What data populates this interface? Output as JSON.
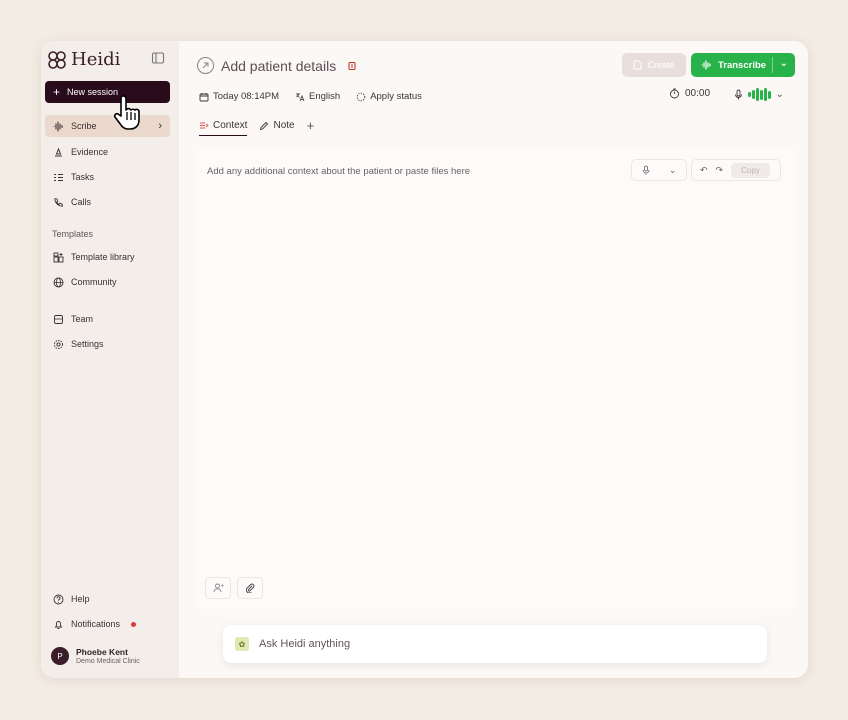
{
  "sidebar": {
    "logo_text": "Heidi",
    "new_session_label": "New session",
    "nav": [
      {
        "label": "Scribe",
        "icon": "waveform-icon"
      },
      {
        "label": "Evidence",
        "icon": "evidence-icon"
      },
      {
        "label": "Tasks",
        "icon": "tasks-icon"
      },
      {
        "label": "Calls",
        "icon": "phone-icon"
      }
    ],
    "templates_heading": "Templates",
    "templates_nav": [
      {
        "label": "Template library",
        "icon": "library-icon"
      },
      {
        "label": "Community",
        "icon": "globe-icon"
      }
    ],
    "admin_nav": [
      {
        "label": "Team",
        "icon": "team-icon"
      },
      {
        "label": "Settings",
        "icon": "gear-icon"
      }
    ],
    "bottom_nav": [
      {
        "label": "Help",
        "icon": "help-icon"
      },
      {
        "label": "Notifications",
        "icon": "bell-icon"
      }
    ],
    "user": {
      "initial": "P",
      "name": "Phoebe Kent",
      "org": "Demo Medical Clinic"
    }
  },
  "header": {
    "title": "Add patient details",
    "create_label": "Create",
    "transcribe_label": "Transcribe"
  },
  "meta": {
    "date": "Today 08:14PM",
    "language": "English",
    "status": "Apply status",
    "timer": "00:00"
  },
  "tabs": [
    {
      "label": "Context",
      "active": true
    },
    {
      "label": "Note",
      "active": false
    }
  ],
  "editor": {
    "placeholder": "Add any additional context about the patient or paste files here",
    "copy_label": "Copy"
  },
  "ask": {
    "placeholder": "Ask Heidi anything"
  },
  "colors": {
    "brand_dark": "#2a0b1c",
    "transcribe_green": "#27b34a",
    "notification_dot": "#d93a3a"
  }
}
